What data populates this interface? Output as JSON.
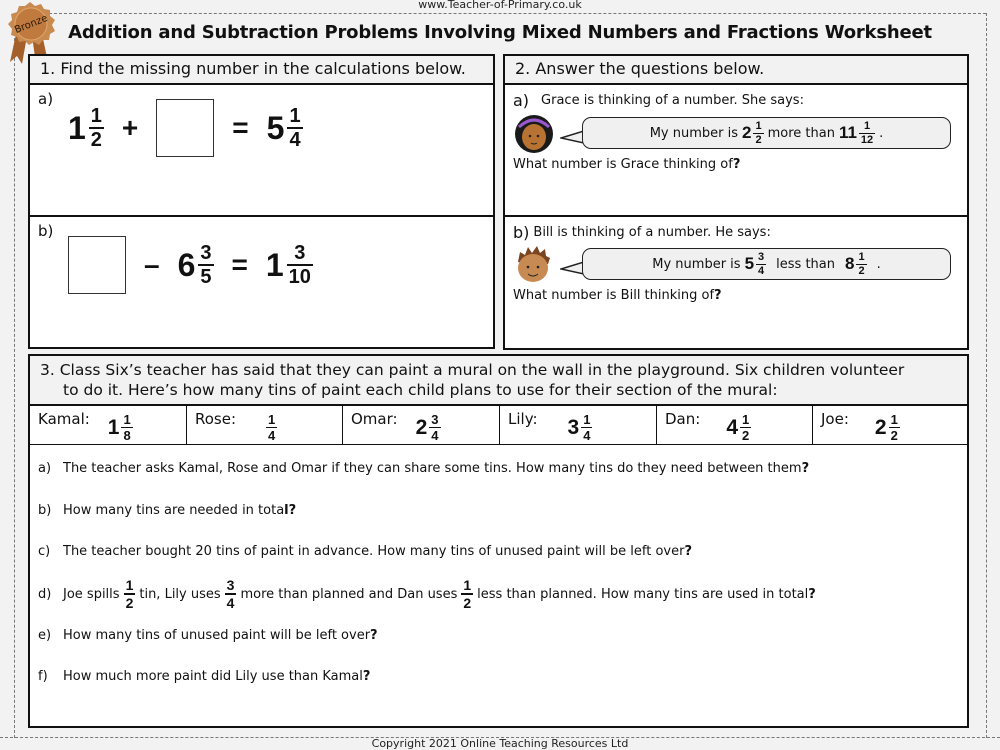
{
  "header": {
    "site_url": "www.Teacher-of-Primary.co.uk",
    "title": "Addition and Subtraction Problems Involving Mixed Numbers and Fractions Worksheet",
    "badge_label": "Bronze",
    "badge_color": "#c07a3e"
  },
  "section1": {
    "heading": "1.   Find the missing number in the calculations below.",
    "a": {
      "label": "a)",
      "term1": {
        "whole": "1",
        "num": "1",
        "den": "2"
      },
      "operator": "+",
      "equals": "=",
      "result": {
        "whole": "5",
        "num": "1",
        "den": "4"
      }
    },
    "b": {
      "label": "b)",
      "operator": "–",
      "term2": {
        "whole": "6",
        "num": "3",
        "den": "5"
      },
      "equals": "=",
      "result": {
        "whole": "1",
        "num": "3",
        "den": "10"
      }
    }
  },
  "section2": {
    "heading": "2.   Answer the questions below.",
    "a": {
      "label": "a)",
      "intro": "Grace is thinking of a number. She says:",
      "bubble_prefix": "My number is",
      "value1": {
        "whole": "2",
        "num": "1",
        "den": "2"
      },
      "bubble_middle": "more than",
      "value2": {
        "whole": "11",
        "num": "1",
        "den": "12"
      },
      "bubble_suffix": ".",
      "question": "What number is Grace thinking of",
      "question_mark": "?"
    },
    "b": {
      "label": "b)",
      "intro": "Bill is thinking of a number. He says:",
      "bubble_prefix": "My number is",
      "value1": {
        "whole": "5",
        "num": "3",
        "den": "4"
      },
      "bubble_middle": "less than",
      "value2": {
        "whole": "8",
        "num": "1",
        "den": "2"
      },
      "bubble_suffix": ".",
      "question": "What number is Bill thinking of",
      "question_mark": "?"
    }
  },
  "section3": {
    "heading_line1": "3.  Class Six’s teacher has said that they can paint a mural on the wall in the playground.  Six children volunteer",
    "heading_line2": "to do it. Here’s how many tins of paint each child plans to use for their section of the mural:",
    "children": [
      {
        "name": "Kamal:",
        "whole": "1",
        "num": "1",
        "den": "8"
      },
      {
        "name": "Rose:",
        "whole": "",
        "num": "1",
        "den": "4"
      },
      {
        "name": "Omar:",
        "whole": "2",
        "num": "3",
        "den": "4"
      },
      {
        "name": "Lily:",
        "whole": "3",
        "num": "1",
        "den": "4"
      },
      {
        "name": "Dan:",
        "whole": "4",
        "num": "1",
        "den": "2"
      },
      {
        "name": "Joe:",
        "whole": "2",
        "num": "1",
        "den": "2"
      }
    ],
    "questions": [
      {
        "label": "a)",
        "text": "The teacher asks Kamal, Rose and Omar if they can share some tins. How many tins do they need between them",
        "mark": "?"
      },
      {
        "label": "b)",
        "text": "How many tins are needed in tota",
        "mark": "l?"
      },
      {
        "label": "c)",
        "text": "The teacher bought 20 tins of paint in advance. How many tins of unused paint will be left over",
        "mark": "?"
      },
      {
        "label": "d)",
        "part1": "Joe spills",
        "f1": {
          "num": "1",
          "den": "2"
        },
        "part2": "tin, Lily uses",
        "f2": {
          "num": "3",
          "den": "4"
        },
        "part3": "more than planned and Dan uses",
        "f3": {
          "num": "1",
          "den": "2"
        },
        "part4": "less than planned. How many tins are used in total",
        "mark": "?"
      },
      {
        "label": "e)",
        "text": "How many tins of unused paint will be left over",
        "mark": "?"
      },
      {
        "label": "f)",
        "text": "How much more paint did Lily use than Kamal",
        "mark": "?"
      }
    ]
  },
  "footer": {
    "copyright": "Copyright 2021 Online Teaching Resources Ltd"
  }
}
